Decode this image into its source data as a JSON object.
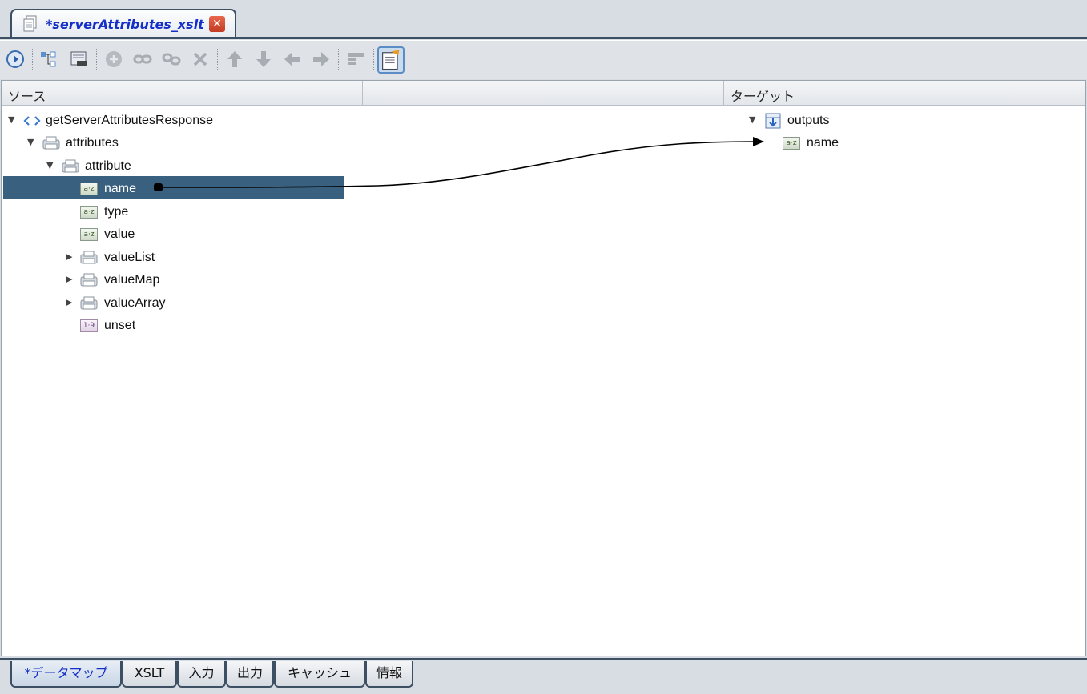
{
  "editor_tab": {
    "title": "*serverAttributes_xslt"
  },
  "toolbar": {
    "buttons": [
      "run-icon",
      "tree-icon",
      "map-icon",
      "add-icon",
      "link-icon",
      "unlink-icon",
      "delete-icon",
      "up-icon",
      "down-icon",
      "left-icon",
      "right-icon",
      "layout-icon",
      "notes-icon"
    ]
  },
  "panel": {
    "source_header": "ソース",
    "target_header": "ターゲット"
  },
  "source_tree": [
    {
      "label": "getServerAttributesResponse",
      "icon": "element-icon",
      "expanded": true
    },
    {
      "label": "attributes",
      "icon": "record-icon",
      "expanded": true
    },
    {
      "label": "attribute",
      "icon": "record-icon",
      "expanded": true
    },
    {
      "label": "name",
      "icon": "string-icon",
      "badge": "a·z",
      "selected": true
    },
    {
      "label": "type",
      "icon": "string-icon",
      "badge": "a·z"
    },
    {
      "label": "value",
      "icon": "string-icon",
      "badge": "a·z"
    },
    {
      "label": "valueList",
      "icon": "record-icon",
      "expanded": false
    },
    {
      "label": "valueMap",
      "icon": "record-icon",
      "expanded": false
    },
    {
      "label": "valueArray",
      "icon": "record-icon",
      "expanded": false
    },
    {
      "label": "unset",
      "icon": "number-icon",
      "badge": "1·9"
    }
  ],
  "target_tree": [
    {
      "label": "outputs",
      "icon": "output-icon",
      "expanded": true
    },
    {
      "label": "name",
      "icon": "string-icon",
      "badge": "a·z"
    }
  ],
  "bottom_tabs": [
    "*データマップ",
    "XSLT",
    "入力",
    "出力",
    "キャッシュ",
    "情報"
  ],
  "colors": {
    "accent": "#1530c8",
    "selection": "#39607f",
    "frame": "#3c4f63"
  }
}
